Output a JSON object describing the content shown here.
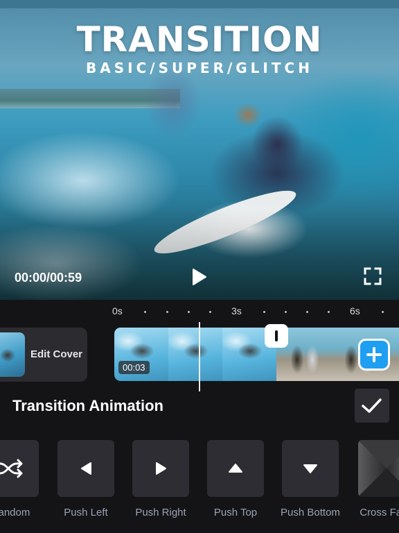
{
  "preview": {
    "title": "TRANSITION",
    "subtitle": "BASIC/SUPER/GLITCH",
    "time_readout": "00:00/00:59",
    "play_icon": "play-icon",
    "fullscreen_icon": "fullscreen-icon"
  },
  "timeline": {
    "ruler_labels": [
      "0s",
      "3s",
      "6s"
    ],
    "cover_label": "Edit Cover",
    "clip_duration": "00:03",
    "transition_marker_icon": "transition-marker-icon",
    "add_clip_icon": "plus-icon"
  },
  "panel": {
    "title": "Transition Animation",
    "confirm_icon": "checkmark-icon",
    "options": [
      {
        "label": "Random",
        "icon": "shuffle-icon"
      },
      {
        "label": "Push Left",
        "icon": "triangle-left-icon"
      },
      {
        "label": "Push Right",
        "icon": "triangle-right-icon"
      },
      {
        "label": "Push Top",
        "icon": "triangle-up-icon"
      },
      {
        "label": "Push Bottom",
        "icon": "triangle-down-icon"
      },
      {
        "label": "Cross Fade",
        "icon": "cross-fade-icon"
      }
    ]
  },
  "colors": {
    "background": "#141416",
    "tile": "#2e2d33",
    "accent_blue": "#1e9ff2",
    "option_label": "#9aa3b4"
  }
}
